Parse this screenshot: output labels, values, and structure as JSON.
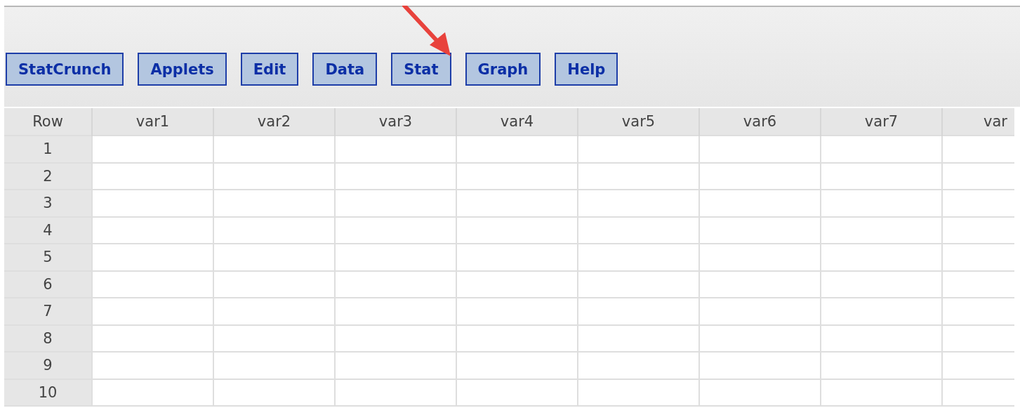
{
  "menu_bar": {
    "buttons": [
      "StatCrunch",
      "Applets",
      "Edit",
      "Data",
      "Stat",
      "Graph",
      "Help"
    ]
  },
  "annotation": {
    "kind": "arrow"
  },
  "table": {
    "row_header": "Row",
    "columns": [
      "var1",
      "var2",
      "var3",
      "var4",
      "var5",
      "var6",
      "var7",
      "var"
    ],
    "rows": [
      "1",
      "2",
      "3",
      "4",
      "5",
      "6",
      "7",
      "8",
      "9",
      "10"
    ]
  }
}
